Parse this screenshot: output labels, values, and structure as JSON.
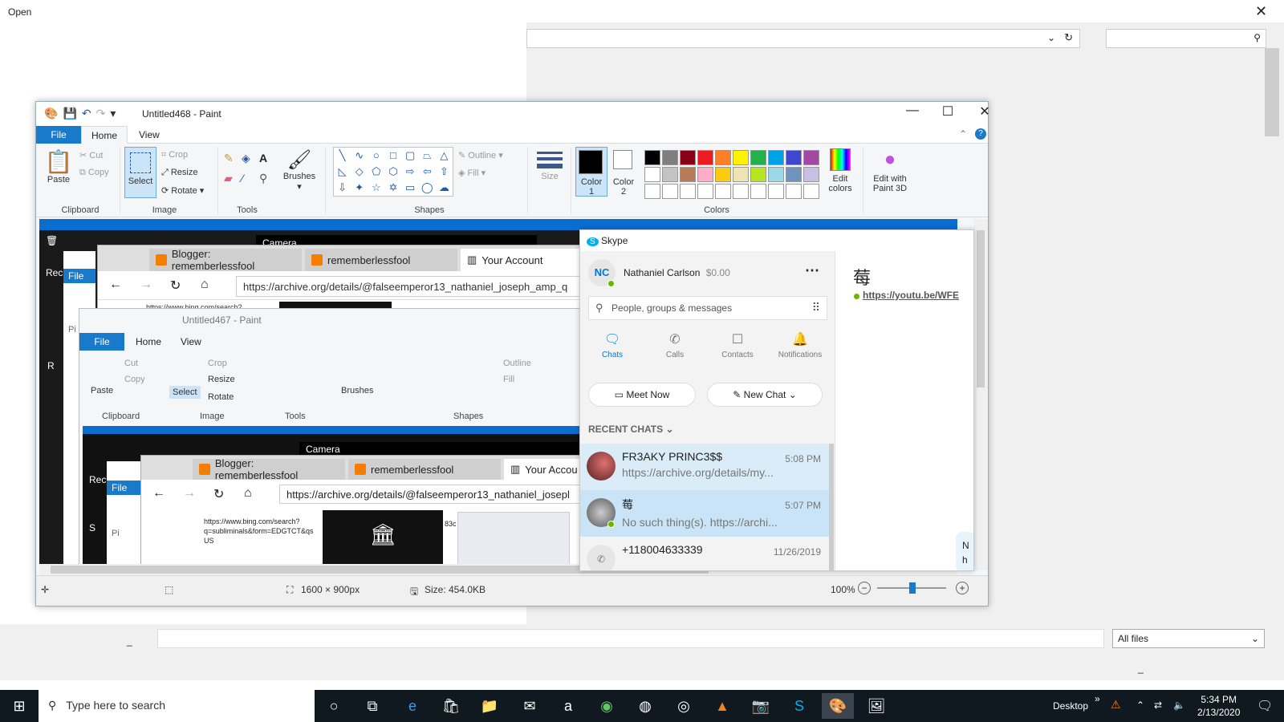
{
  "open_dialog": {
    "title": "Open",
    "close_icon": "close-icon",
    "file_type": "All files",
    "small_mark": "_",
    "small_mark2": "_"
  },
  "paint": {
    "title": "Untitled468 - Paint",
    "tabs": {
      "file": "File",
      "home": "Home",
      "view": "View"
    },
    "clipboard": {
      "paste": "Paste",
      "cut": "Cut",
      "copy": "Copy",
      "label": "Clipboard"
    },
    "image": {
      "select": "Select",
      "crop": "Crop",
      "resize": "Resize",
      "rotate": "Rotate",
      "label": "Image"
    },
    "tools": {
      "label": "Tools",
      "brushes": "Brushes"
    },
    "shapes": {
      "label": "Shapes",
      "outline": "Outline",
      "fill": "Fill",
      "size": "Size"
    },
    "colors": {
      "color1": "Color",
      "color1_num": "1",
      "color2": "Color",
      "color2_num": "2",
      "edit": "Edit",
      "edit2": "colors",
      "label": "Colors",
      "paint3d": "Edit with",
      "paint3d2": "Paint 3D"
    },
    "palette": [
      "#000000",
      "#7f7f7f",
      "#880015",
      "#ed1c24",
      "#ff7f27",
      "#fff200",
      "#22b14c",
      "#00a2e8",
      "#3f48cc",
      "#a349a4",
      "#ffffff",
      "#c3c3c3",
      "#b97a57",
      "#ffaec9",
      "#ffc90e",
      "#efe4b0",
      "#b5e61d",
      "#99d9ea",
      "#7092be",
      "#c8bfe7",
      "#ffffff",
      "#ffffff",
      "#ffffff",
      "#ffffff",
      "#ffffff",
      "#ffffff",
      "#ffffff",
      "#ffffff",
      "#ffffff",
      "#ffffff"
    ],
    "status": {
      "dimensions": "1600 × 900px",
      "size": "Size: 454.0KB",
      "zoom": "100%"
    }
  },
  "inner": {
    "camera": "Camera",
    "recycle": "Rec",
    "file": "File",
    "tab1": "Blogger: rememberlessfool",
    "tab2": "rememberlessfool",
    "tab3": "Your Account",
    "url": "https://archive.org/details/@falseemperor13_nathaniel_joseph_amp_q",
    "bing": "https://www.bing.com/search?",
    "paint_title": "Untitled467 - Paint",
    "tab3b": "Your Accou",
    "url_b": "https://archive.org/details/@falseemperor13_nathaniel_josepl",
    "bing2": "https://www.bing.com/search?",
    "bing3": "q=subliminals&form=EDGTCT&qs",
    "bing4": "US",
    "bing_misc": "83c",
    "camera_b": "Camera",
    "recycle_b": "Rec",
    "file_b": "File",
    "pi": "Pi",
    "pi_b": "Pi",
    "r_letter": "R",
    "s_letter": "S"
  },
  "skype": {
    "title": "Skype",
    "user_initials": "NC",
    "user_name": "Nathaniel Carlson",
    "balance": "$0.00",
    "search_placeholder": "People, groups & messages",
    "nav": [
      "Chats",
      "Calls",
      "Contacts",
      "Notifications"
    ],
    "meet_now": "Meet Now",
    "new_chat": "New Chat",
    "recent": "RECENT CHATS",
    "chats": [
      {
        "name": "FR3AKY PRINC3$$",
        "msg": "https://archive.org/details/my...",
        "time": "5:08 PM"
      },
      {
        "name": "莓",
        "msg": "No such thing(s). https://archi...",
        "time": "5:07 PM"
      },
      {
        "name": "+118004633339",
        "msg": "",
        "time": "11/26/2019"
      }
    ],
    "right_glyph": "莓",
    "right_link": "https://youtu.be/WFE",
    "right_n": "N",
    "right_h": "h"
  },
  "taskbar": {
    "search": "Type here to search",
    "desktop": "Desktop",
    "time": "5:34 PM",
    "date": "2/13/2020"
  }
}
